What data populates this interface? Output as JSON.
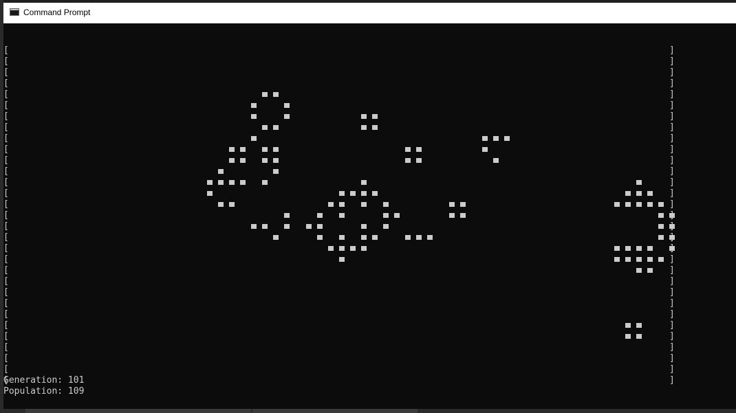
{
  "window": {
    "title": "Command Prompt"
  },
  "console": {
    "open_bracket": "[",
    "close_bracket": "]",
    "rows": 31,
    "generation_label": "Generation: 101",
    "population_label": "Population: 109",
    "grid_live_cells": [
      [
        4,
        23
      ],
      [
        4,
        24
      ],
      [
        5,
        22
      ],
      [
        5,
        25
      ],
      [
        6,
        22
      ],
      [
        6,
        25
      ],
      [
        6,
        32
      ],
      [
        6,
        33
      ],
      [
        7,
        23
      ],
      [
        7,
        24
      ],
      [
        7,
        32
      ],
      [
        7,
        33
      ],
      [
        8,
        22
      ],
      [
        8,
        43
      ],
      [
        8,
        44
      ],
      [
        8,
        45
      ],
      [
        9,
        20
      ],
      [
        9,
        21
      ],
      [
        9,
        23
      ],
      [
        9,
        24
      ],
      [
        9,
        36
      ],
      [
        9,
        37
      ],
      [
        9,
        43
      ],
      [
        10,
        20
      ],
      [
        10,
        21
      ],
      [
        10,
        23
      ],
      [
        10,
        24
      ],
      [
        10,
        36
      ],
      [
        10,
        37
      ],
      [
        10,
        44
      ],
      [
        11,
        19
      ],
      [
        11,
        24
      ],
      [
        12,
        18
      ],
      [
        12,
        19
      ],
      [
        12,
        20
      ],
      [
        12,
        21
      ],
      [
        12,
        23
      ],
      [
        12,
        32
      ],
      [
        12,
        57
      ],
      [
        13,
        18
      ],
      [
        13,
        30
      ],
      [
        13,
        31
      ],
      [
        13,
        32
      ],
      [
        13,
        33
      ],
      [
        13,
        56
      ],
      [
        13,
        57
      ],
      [
        13,
        58
      ],
      [
        14,
        19
      ],
      [
        14,
        20
      ],
      [
        14,
        29
      ],
      [
        14,
        30
      ],
      [
        14,
        32
      ],
      [
        14,
        34
      ],
      [
        14,
        40
      ],
      [
        14,
        41
      ],
      [
        14,
        55
      ],
      [
        14,
        56
      ],
      [
        14,
        57
      ],
      [
        14,
        58
      ],
      [
        14,
        59
      ],
      [
        15,
        25
      ],
      [
        15,
        28
      ],
      [
        15,
        30
      ],
      [
        15,
        34
      ],
      [
        15,
        35
      ],
      [
        15,
        40
      ],
      [
        15,
        41
      ],
      [
        15,
        59
      ],
      [
        15,
        60
      ],
      [
        16,
        22
      ],
      [
        16,
        23
      ],
      [
        16,
        25
      ],
      [
        16,
        27
      ],
      [
        16,
        28
      ],
      [
        16,
        32
      ],
      [
        16,
        34
      ],
      [
        16,
        59
      ],
      [
        16,
        60
      ],
      [
        17,
        24
      ],
      [
        17,
        28
      ],
      [
        17,
        30
      ],
      [
        17,
        32
      ],
      [
        17,
        33
      ],
      [
        17,
        36
      ],
      [
        17,
        37
      ],
      [
        17,
        38
      ],
      [
        17,
        59
      ],
      [
        17,
        60
      ],
      [
        18,
        29
      ],
      [
        18,
        30
      ],
      [
        18,
        31
      ],
      [
        18,
        32
      ],
      [
        18,
        55
      ],
      [
        18,
        56
      ],
      [
        18,
        57
      ],
      [
        18,
        58
      ],
      [
        18,
        60
      ],
      [
        19,
        30
      ],
      [
        19,
        55
      ],
      [
        19,
        56
      ],
      [
        19,
        57
      ],
      [
        19,
        58
      ],
      [
        19,
        59
      ],
      [
        20,
        57
      ],
      [
        20,
        58
      ],
      [
        25,
        56
      ],
      [
        25,
        57
      ],
      [
        26,
        56
      ],
      [
        26,
        57
      ]
    ]
  }
}
